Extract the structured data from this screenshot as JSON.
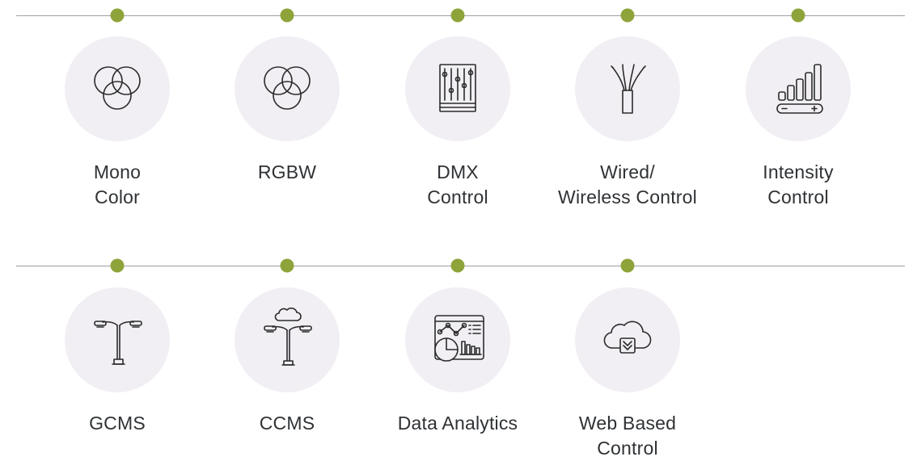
{
  "rows": [
    {
      "features": [
        {
          "icon": "overlapping-circles-icon",
          "label_lines": [
            "Mono",
            "Color"
          ]
        },
        {
          "icon": "overlapping-circles-icon",
          "label_lines": [
            "RGBW",
            ""
          ]
        },
        {
          "icon": "sliders-panel-icon",
          "label_lines": [
            "DMX",
            "Control"
          ]
        },
        {
          "icon": "cable-wires-icon",
          "label_lines": [
            "Wired/",
            "Wireless Control"
          ]
        },
        {
          "icon": "signal-bars-icon",
          "label_lines": [
            "Intensity",
            "Control"
          ]
        }
      ]
    },
    {
      "features": [
        {
          "icon": "street-lamp-icon",
          "label_lines": [
            "GCMS",
            ""
          ]
        },
        {
          "icon": "cloud-street-lamp-icon",
          "label_lines": [
            "CCMS",
            ""
          ]
        },
        {
          "icon": "analytics-dashboard-icon",
          "label_lines": [
            "Data Analytics",
            ""
          ]
        },
        {
          "icon": "cloud-download-icon",
          "label_lines": [
            "Web Based",
            "Control"
          ]
        }
      ]
    }
  ],
  "colors": {
    "accent_dot": "#8ea43b",
    "icon_circle_bg": "#f1eff4",
    "timeline_line": "#9c9ea3",
    "label_text": "#2f3235"
  }
}
